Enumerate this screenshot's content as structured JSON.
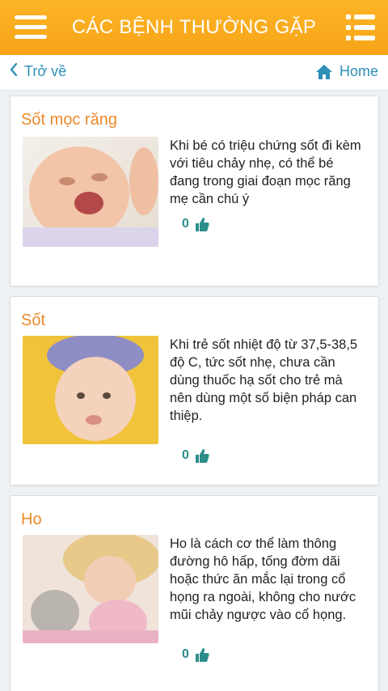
{
  "header": {
    "title": "CÁC BỆNH THƯỜNG GẶP",
    "menu_icon": "hamburger-icon",
    "list_icon": "list-menu-icon",
    "color": "#f8a81b"
  },
  "nav": {
    "back_label": "Trở về",
    "home_label": "Home",
    "link_color": "#2e8fb8"
  },
  "articles": [
    {
      "title": "Sốt mọc răng",
      "description": "Khi bé có triệu chứng sốt đi kèm với tiêu chảy nhẹ, có thể bé đang trong giai đoạn mọc răng mẹ cần chú ý",
      "likes": "0",
      "image": "crying-baby-teething-photo"
    },
    {
      "title": "Sốt",
      "description": "Khi trẻ sốt nhiệt độ từ 37,5-38,5 độ C, tức sốt nhẹ, chưa cần dùng thuốc hạ sốt cho trẻ mà nên dùng một số biện pháp can thiệp.",
      "likes": "0",
      "image": "baby-with-ice-pack-photo"
    },
    {
      "title": "Ho",
      "description": "Ho là cách cơ thể làm thông đường hô hấp, tống đờm dãi hoặc thức ăn mắc lại trong cổ họng ra ngoài, không cho nước mũi chảy ngược vào cổ họng.",
      "likes": "0",
      "image": "coughing-girl-photo"
    }
  ]
}
